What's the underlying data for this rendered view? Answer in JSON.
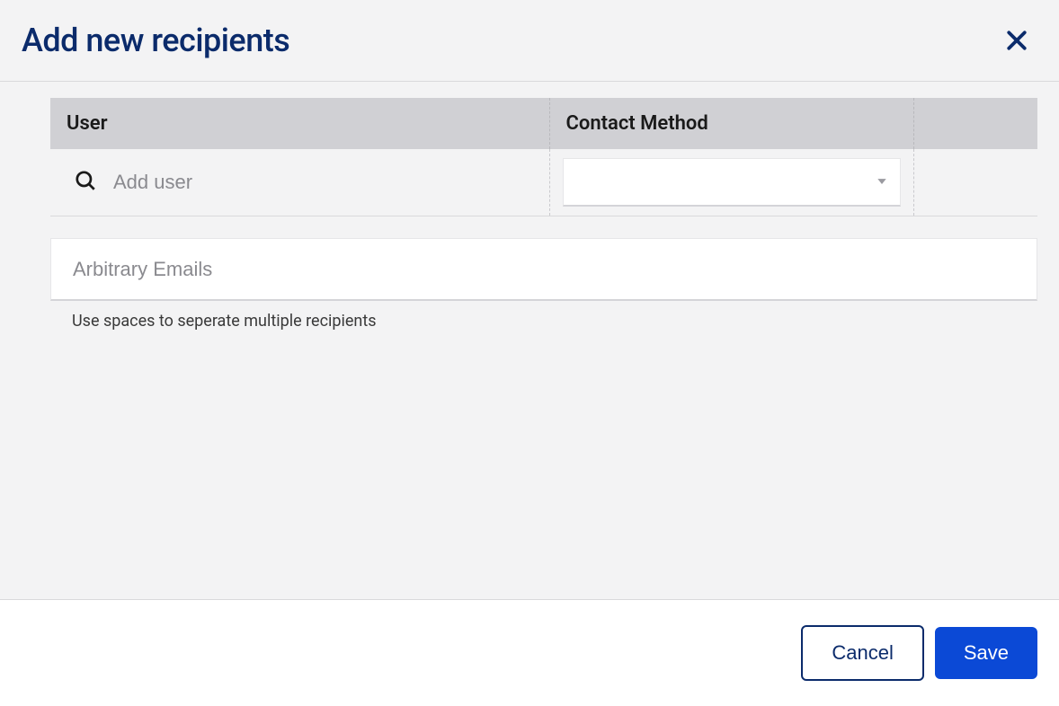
{
  "header": {
    "title": "Add new recipients"
  },
  "table": {
    "columns": {
      "user": "User",
      "contact": "Contact Method"
    },
    "userInput": {
      "value": "",
      "placeholder": "Add user"
    },
    "contactSelect": {
      "value": ""
    }
  },
  "emails": {
    "placeholder": "Arbitrary Emails",
    "value": "",
    "hint": "Use spaces to seperate multiple recipients"
  },
  "footer": {
    "cancel": "Cancel",
    "save": "Save"
  }
}
